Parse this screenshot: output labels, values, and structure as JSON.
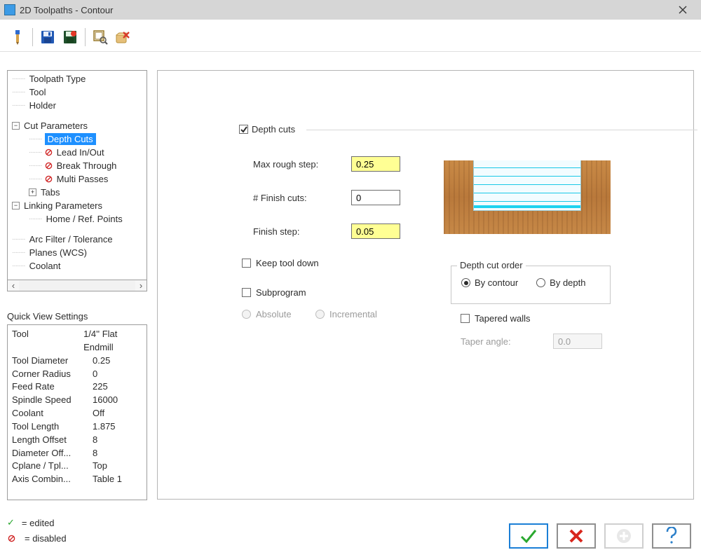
{
  "title": "2D Toolpaths - Contour",
  "tree": {
    "items": [
      {
        "label": "Toolpath Type",
        "depth": 1
      },
      {
        "label": "Tool",
        "depth": 1
      },
      {
        "label": "Holder",
        "depth": 1
      },
      {
        "spacer": true
      },
      {
        "label": "Cut Parameters",
        "depth": 1,
        "toggle": "-"
      },
      {
        "label": "Depth Cuts",
        "depth": 2,
        "selected": true
      },
      {
        "label": "Lead In/Out",
        "depth": 2,
        "disabled": true
      },
      {
        "label": "Break Through",
        "depth": 2,
        "disabled": true
      },
      {
        "label": "Multi Passes",
        "depth": 2,
        "disabled": true
      },
      {
        "label": "Tabs",
        "depth": 2,
        "toggle": "+"
      },
      {
        "label": "Linking Parameters",
        "depth": 1,
        "toggle": "-"
      },
      {
        "label": "Home / Ref. Points",
        "depth": 2
      },
      {
        "spacer": true
      },
      {
        "label": "Arc Filter / Tolerance",
        "depth": 1
      },
      {
        "label": "Planes (WCS)",
        "depth": 1
      },
      {
        "label": "Coolant",
        "depth": 1
      }
    ]
  },
  "quickview": {
    "title": "Quick View Settings",
    "rows": [
      {
        "k": "Tool",
        "v": "1/4'' Flat Endmill"
      },
      {
        "k": "Tool Diameter",
        "v": "0.25"
      },
      {
        "k": "Corner Radius",
        "v": "0"
      },
      {
        "k": "Feed Rate",
        "v": "225"
      },
      {
        "k": "Spindle Speed",
        "v": "16000"
      },
      {
        "k": "Coolant",
        "v": "Off"
      },
      {
        "k": "Tool Length",
        "v": "1.875"
      },
      {
        "k": "Length Offset",
        "v": "8"
      },
      {
        "k": "Diameter Off...",
        "v": "8"
      },
      {
        "k": "Cplane / Tpl...",
        "v": "Top"
      },
      {
        "k": "Axis Combin...",
        "v": "Table 1"
      }
    ]
  },
  "content": {
    "section_title": "Depth cuts",
    "max_rough_label": "Max rough step:",
    "max_rough_value": "0.25",
    "finish_cuts_label": "# Finish cuts:",
    "finish_cuts_value": "0",
    "finish_step_label": "Finish step:",
    "finish_step_value": "0.05",
    "keep_tool_down": "Keep tool down",
    "subprogram": "Subprogram",
    "absolute": "Absolute",
    "incremental": "Incremental",
    "order_title": "Depth cut order",
    "by_contour": "By contour",
    "by_depth": "By depth",
    "tapered_walls": "Tapered walls",
    "taper_angle_label": "Taper angle:",
    "taper_angle_value": "0.0"
  },
  "legend": {
    "edited": "= edited",
    "disabled": "= disabled"
  }
}
